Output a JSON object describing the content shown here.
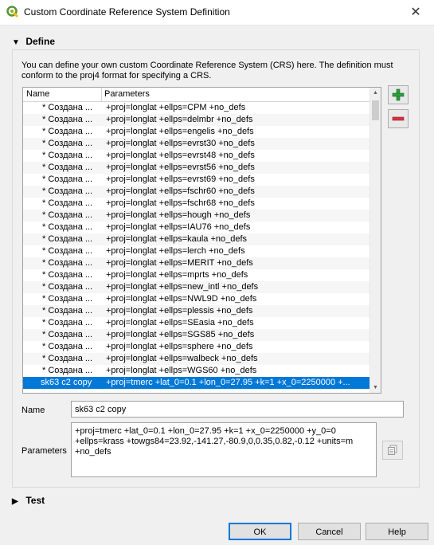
{
  "window": {
    "title": "Custom Coordinate Reference System Definition",
    "close_glyph": "✕"
  },
  "define": {
    "header": "Define",
    "arrow": "▼",
    "description": "You can define your own custom Coordinate Reference System (CRS) here. The definition must conform to the proj4 format for specifying a CRS."
  },
  "table": {
    "columns": [
      "Name",
      "Parameters"
    ],
    "rows": [
      {
        "name": "* Создана ...",
        "params": "+proj=longlat +ellps=CPM +no_defs"
      },
      {
        "name": "* Создана ...",
        "params": "+proj=longlat +ellps=delmbr +no_defs"
      },
      {
        "name": "* Создана ...",
        "params": "+proj=longlat +ellps=engelis +no_defs"
      },
      {
        "name": "* Создана ...",
        "params": "+proj=longlat +ellps=evrst30 +no_defs"
      },
      {
        "name": "* Создана ...",
        "params": "+proj=longlat +ellps=evrst48 +no_defs"
      },
      {
        "name": "* Создана ...",
        "params": "+proj=longlat +ellps=evrst56 +no_defs"
      },
      {
        "name": "* Создана ...",
        "params": "+proj=longlat +ellps=evrst69 +no_defs"
      },
      {
        "name": "* Создана ...",
        "params": "+proj=longlat +ellps=fschr60 +no_defs"
      },
      {
        "name": "* Создана ...",
        "params": "+proj=longlat +ellps=fschr68 +no_defs"
      },
      {
        "name": "* Создана ...",
        "params": "+proj=longlat +ellps=hough +no_defs"
      },
      {
        "name": "* Создана ...",
        "params": "+proj=longlat +ellps=IAU76 +no_defs"
      },
      {
        "name": "* Создана ...",
        "params": "+proj=longlat +ellps=kaula +no_defs"
      },
      {
        "name": "* Создана ...",
        "params": "+proj=longlat +ellps=lerch +no_defs"
      },
      {
        "name": "* Создана ...",
        "params": "+proj=longlat +ellps=MERIT +no_defs"
      },
      {
        "name": "* Создана ...",
        "params": "+proj=longlat +ellps=mprts +no_defs"
      },
      {
        "name": "* Создана ...",
        "params": "+proj=longlat +ellps=new_intl +no_defs"
      },
      {
        "name": "* Создана ...",
        "params": "+proj=longlat +ellps=NWL9D +no_defs"
      },
      {
        "name": "* Создана ...",
        "params": "+proj=longlat +ellps=plessis +no_defs"
      },
      {
        "name": "* Создана ...",
        "params": "+proj=longlat +ellps=SEasia +no_defs"
      },
      {
        "name": "* Создана ...",
        "params": "+proj=longlat +ellps=SGS85 +no_defs"
      },
      {
        "name": "* Создана ...",
        "params": "+proj=longlat +ellps=sphere +no_defs"
      },
      {
        "name": "* Создана ...",
        "params": "+proj=longlat +ellps=walbeck +no_defs"
      },
      {
        "name": "* Создана ...",
        "params": "+proj=longlat +ellps=WGS60 +no_defs"
      },
      {
        "name": "sk63 c2 copy",
        "params": "+proj=tmerc +lat_0=0.1 +lon_0=27.95 +k=1 +x_0=2250000 +...",
        "selected": true
      }
    ]
  },
  "form": {
    "name_label": "Name",
    "name_value": "sk63 c2 copy",
    "params_label": "Parameters",
    "params_value": "+proj=tmerc +lat_0=0.1 +lon_0=27.95 +k=1 +x_0=2250000 +y_0=0\n+ellps=krass +towgs84=23.92,-141.27,-80.9,0,0.35,0.82,-0.12 +units=m\n+no_defs"
  },
  "test": {
    "header": "Test",
    "arrow": "▶"
  },
  "buttons": {
    "ok": "OK",
    "cancel": "Cancel",
    "help": "Help"
  },
  "colors": {
    "selection": "#0078d7",
    "add_icon": "#2e9e3a",
    "remove_icon": "#d9333f"
  }
}
